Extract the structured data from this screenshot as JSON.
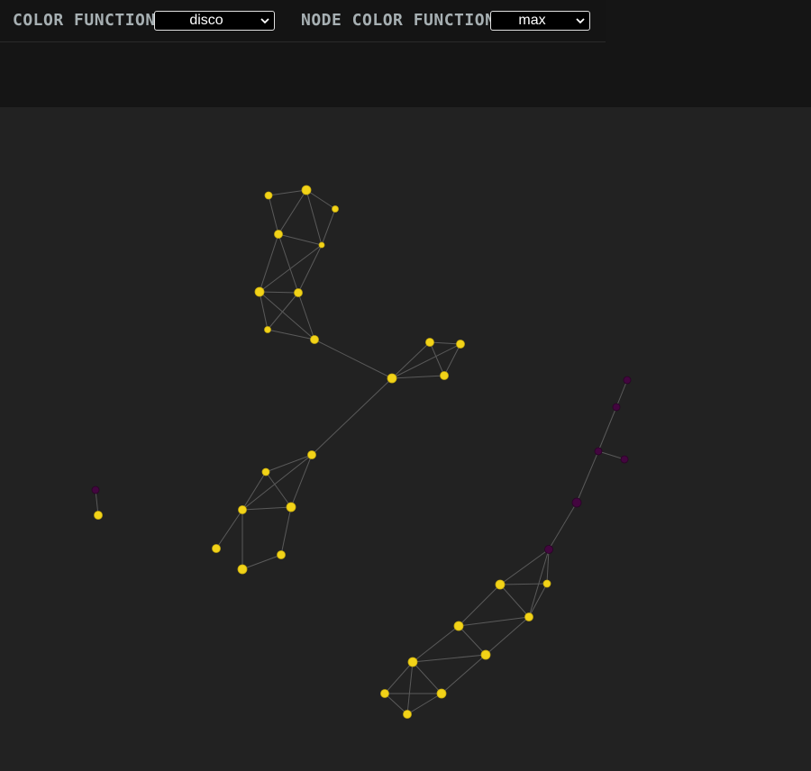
{
  "controls": {
    "color_function_label": "COLOR FUNCTION",
    "color_function_value": "disco",
    "node_color_function_label": "NODE COLOR FUNCTION",
    "node_color_function_value": "max"
  },
  "colors": {
    "background": "#222222",
    "toolbar": "#141414",
    "edge": "#5a5a5a",
    "node_yellow": "#f2d318",
    "node_purple": "#43063f"
  },
  "graph": {
    "nodes": [
      {
        "id": "n1",
        "color": "yellow"
      },
      {
        "id": "n2",
        "color": "yellow"
      },
      {
        "id": "n3",
        "color": "yellow"
      },
      {
        "id": "n4",
        "color": "yellow"
      },
      {
        "id": "n5",
        "color": "yellow"
      },
      {
        "id": "n6",
        "color": "yellow"
      },
      {
        "id": "n7",
        "color": "yellow"
      },
      {
        "id": "n8",
        "color": "yellow"
      },
      {
        "id": "n9",
        "color": "yellow"
      },
      {
        "id": "n10",
        "color": "yellow"
      },
      {
        "id": "n11",
        "color": "yellow"
      },
      {
        "id": "n12",
        "color": "yellow"
      },
      {
        "id": "n13",
        "color": "yellow"
      },
      {
        "id": "n14",
        "color": "yellow"
      },
      {
        "id": "n15",
        "color": "yellow"
      },
      {
        "id": "n16",
        "color": "yellow"
      },
      {
        "id": "n17",
        "color": "yellow"
      },
      {
        "id": "n18",
        "color": "yellow"
      },
      {
        "id": "n19",
        "color": "yellow"
      },
      {
        "id": "n20",
        "color": "yellow"
      },
      {
        "id": "n21",
        "color": "purple"
      },
      {
        "id": "n22",
        "color": "yellow"
      },
      {
        "id": "n23",
        "color": "purple"
      },
      {
        "id": "n24",
        "color": "purple"
      },
      {
        "id": "n25",
        "color": "purple"
      },
      {
        "id": "n26",
        "color": "purple"
      },
      {
        "id": "n27",
        "color": "purple"
      },
      {
        "id": "n28",
        "color": "purple"
      },
      {
        "id": "n29",
        "color": "yellow"
      },
      {
        "id": "n30",
        "color": "yellow"
      },
      {
        "id": "n31",
        "color": "yellow"
      },
      {
        "id": "n32",
        "color": "yellow"
      },
      {
        "id": "n33",
        "color": "yellow"
      },
      {
        "id": "n34",
        "color": "yellow"
      },
      {
        "id": "n35",
        "color": "yellow"
      },
      {
        "id": "n36",
        "color": "yellow"
      }
    ],
    "edges": [
      [
        "n1",
        "n2"
      ],
      [
        "n2",
        "n3"
      ],
      [
        "n1",
        "n4"
      ],
      [
        "n2",
        "n4"
      ],
      [
        "n2",
        "n5"
      ],
      [
        "n3",
        "n5"
      ],
      [
        "n4",
        "n5"
      ],
      [
        "n4",
        "n6"
      ],
      [
        "n4",
        "n7"
      ],
      [
        "n5",
        "n7"
      ],
      [
        "n5",
        "n6"
      ],
      [
        "n6",
        "n7"
      ],
      [
        "n6",
        "n8"
      ],
      [
        "n6",
        "n9"
      ],
      [
        "n7",
        "n9"
      ],
      [
        "n7",
        "n8"
      ],
      [
        "n8",
        "n9"
      ],
      [
        "n9",
        "n10"
      ],
      [
        "n10",
        "n11"
      ],
      [
        "n10",
        "n12"
      ],
      [
        "n10",
        "n13"
      ],
      [
        "n11",
        "n12"
      ],
      [
        "n11",
        "n13"
      ],
      [
        "n12",
        "n13"
      ],
      [
        "n10",
        "n14"
      ],
      [
        "n14",
        "n15"
      ],
      [
        "n14",
        "n16"
      ],
      [
        "n14",
        "n17"
      ],
      [
        "n15",
        "n16"
      ],
      [
        "n15",
        "n17"
      ],
      [
        "n16",
        "n17"
      ],
      [
        "n16",
        "n18"
      ],
      [
        "n16",
        "n19"
      ],
      [
        "n17",
        "n20"
      ],
      [
        "n19",
        "n20"
      ],
      [
        "n21",
        "n22"
      ],
      [
        "n23",
        "n24"
      ],
      [
        "n24",
        "n25"
      ],
      [
        "n25",
        "n26"
      ],
      [
        "n25",
        "n27"
      ],
      [
        "n27",
        "n28"
      ],
      [
        "n28",
        "n29"
      ],
      [
        "n28",
        "n31"
      ],
      [
        "n28",
        "n30"
      ],
      [
        "n29",
        "n30"
      ],
      [
        "n29",
        "n31"
      ],
      [
        "n29",
        "n32"
      ],
      [
        "n30",
        "n31"
      ],
      [
        "n31",
        "n32"
      ],
      [
        "n31",
        "n33"
      ],
      [
        "n32",
        "n33"
      ],
      [
        "n32",
        "n34"
      ],
      [
        "n33",
        "n34"
      ],
      [
        "n33",
        "n36"
      ],
      [
        "n34",
        "n35"
      ],
      [
        "n34",
        "n36"
      ],
      [
        "n35",
        "n36"
      ]
    ]
  }
}
